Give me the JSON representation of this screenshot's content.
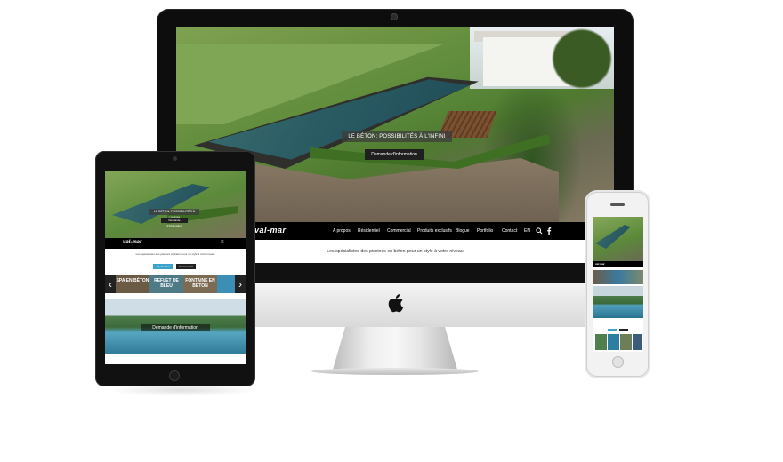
{
  "desktop": {
    "hero_caption": "LE BÉTON: POSSIBILITÉS À L'INFINI",
    "hero_cta": "Demande d'information",
    "logo": "val-mar",
    "nav": [
      "A propos",
      "Résidentiel",
      "Commercial",
      "Produits exclusifs",
      "Blogue",
      "Portfolio",
      "Contact",
      "EN"
    ],
    "tagline": "Les spécialistes des piscines en béton pour un style à votre niveau"
  },
  "tablet": {
    "hero_caption": "LE BÉTON: POSSIBILITÉS À L'INFINI",
    "hero_cta": "Demande d'information",
    "logo": "val-mar",
    "menu_icon": "≡",
    "tagline": "Les spécialistes des piscines en béton pour un style à votre niveau",
    "button_residential": "Résidentiel",
    "button_commercial": "Commercial",
    "tiles": [
      "SPA EN BÉTON",
      "REFLET DE BLEU",
      "FONTAINE EN BÉTON"
    ],
    "photo_caption": "Demande d'information"
  },
  "phone": {
    "logo": "val-mar"
  },
  "colors": {
    "accent": "#3aa3c9",
    "nav_bg": "#000000"
  }
}
